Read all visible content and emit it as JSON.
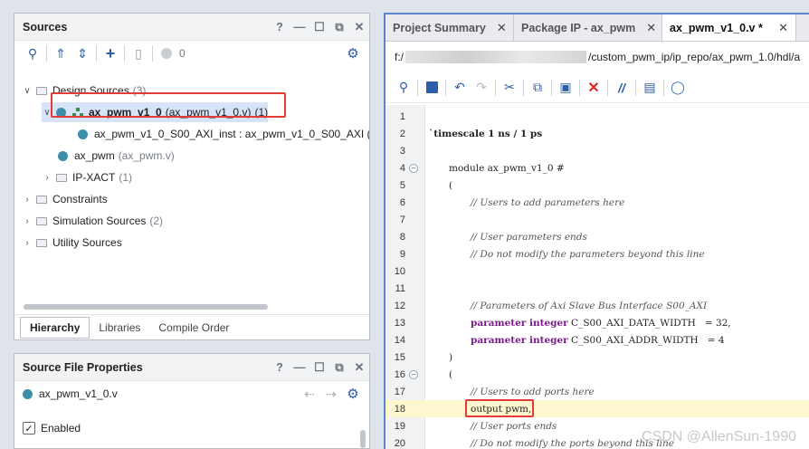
{
  "sources": {
    "title": "Sources",
    "controls": [
      "?",
      "—",
      "☐",
      "⧉",
      "✕"
    ],
    "toolbar": {
      "count": "0"
    },
    "tree": {
      "design_sources": {
        "label": "Design Sources",
        "count": "(3)"
      },
      "top_module": {
        "name": "ax_pwm_v1_0",
        "file": "(ax_pwm_v1_0.v)",
        "count": "(1)"
      },
      "instance": {
        "label": "ax_pwm_v1_0_S00_AXI_inst : ax_pwm_v1_0_S00_AXI ("
      },
      "ax_pwm": {
        "name": "ax_pwm",
        "file": "(ax_pwm.v)"
      },
      "ipxact": {
        "label": "IP-XACT",
        "count": "(1)"
      },
      "constraints": {
        "label": "Constraints"
      },
      "simulation": {
        "label": "Simulation Sources",
        "count": "(2)"
      },
      "utility": {
        "label": "Utility Sources"
      }
    },
    "tabs": [
      "Hierarchy",
      "Libraries",
      "Compile Order"
    ]
  },
  "properties": {
    "title": "Source File Properties",
    "file": "ax_pwm_v1_0.v",
    "enabled_label": "Enabled",
    "enabled": true
  },
  "editor": {
    "tabs": [
      {
        "label": "Project Summary",
        "active": false
      },
      {
        "label": "Package IP - ax_pwm",
        "active": false
      },
      {
        "label": "ax_pwm_v1_0.v *",
        "active": true
      }
    ],
    "path_prefix": "f:/",
    "path_suffix": "/custom_pwm_ip/ip_repo/ax_pwm_1.0/hdl/a",
    "lines": [
      {
        "n": "1",
        "text": ""
      },
      {
        "n": "2",
        "text": "`timescale 1 ns / 1 ps"
      },
      {
        "n": "3",
        "text": ""
      },
      {
        "n": "4",
        "text": "module ax_pwm_v1_0 #"
      },
      {
        "n": "5",
        "text": "("
      },
      {
        "n": "6",
        "text": "// Users to add parameters here"
      },
      {
        "n": "7",
        "text": ""
      },
      {
        "n": "8",
        "text": "// User parameters ends"
      },
      {
        "n": "9",
        "text": "// Do not modify the parameters beyond this line"
      },
      {
        "n": "10",
        "text": ""
      },
      {
        "n": "11",
        "text": ""
      },
      {
        "n": "12",
        "text": "// Parameters of Axi Slave Bus Interface S00_AXI"
      },
      {
        "n": "13",
        "kw": "parameter integer",
        "text": "C_S00_AXI_DATA_WIDTH   = 32,"
      },
      {
        "n": "14",
        "kw": "parameter integer",
        "text": "C_S00_AXI_ADDR_WIDTH   = 4"
      },
      {
        "n": "15",
        "text": ")"
      },
      {
        "n": "16",
        "text": "("
      },
      {
        "n": "17",
        "text": "// Users to add ports here"
      },
      {
        "n": "18",
        "text": "output pwm,"
      },
      {
        "n": "19",
        "text": "// User ports ends"
      },
      {
        "n": "20",
        "text": "// Do not modify the ports beyond this line"
      }
    ],
    "watermark": "CSDN @AllenSun-1990"
  }
}
